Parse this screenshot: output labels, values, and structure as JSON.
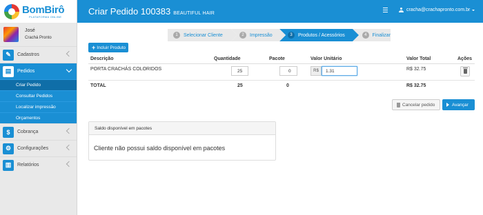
{
  "brand": {
    "name": "BomBirô",
    "subtitle": "PLATAFORMA ONLINE"
  },
  "user": {
    "name": "José",
    "company": "Crachá Pronto"
  },
  "sidebar": {
    "items": [
      {
        "label": "Cadastros",
        "icon": "pencil-icon"
      },
      {
        "label": "Pedidos",
        "icon": "document-icon",
        "active": true
      },
      {
        "label": "Cobrança",
        "icon": "dollar-icon"
      },
      {
        "label": "Configurações",
        "icon": "gears-icon"
      },
      {
        "label": "Relatórios",
        "icon": "bar-chart-icon"
      }
    ],
    "submenu": [
      "Criar Pedido",
      "Consultar Pedidos",
      "Localizar impressão",
      "Orçamentos"
    ]
  },
  "header": {
    "title": "Criar Pedido 100383",
    "subtitle": "BEAUTIFUL HAIR",
    "user_email": "cracha@crachapronto.com.br"
  },
  "wizard": {
    "steps": [
      {
        "num": "1",
        "label": "Selecionar Cliente"
      },
      {
        "num": "2",
        "label": "Impressão"
      },
      {
        "num": "3",
        "label": "Produtos / Acessórios",
        "active": true
      },
      {
        "num": "4",
        "label": "Finalizar"
      }
    ]
  },
  "toolbar": {
    "add_product": "Incluir Produto"
  },
  "table": {
    "headers": {
      "description": "Descrição",
      "quantity": "Quantidade",
      "package": "Pacote",
      "unit_value": "Valor Unitário",
      "total_value": "Valor Total",
      "actions": "Ações"
    },
    "rows": [
      {
        "description": "PORTA CRACHÁS COLORIDOS",
        "quantity": "25",
        "package": "0",
        "currency": "R$",
        "unit_value": "1.31",
        "total_value": "R$ 32.75"
      }
    ],
    "total": {
      "label": "TOTAL",
      "quantity": "25",
      "package": "0",
      "total_value": "R$ 32.75"
    }
  },
  "actions": {
    "cancel": "Cancelar pedido",
    "next": "Avançar"
  },
  "balance_panel": {
    "title": "Saldo disponível em pacotes",
    "message": "Cliente não possui saldo disponível em pacotes"
  },
  "colors": {
    "primary": "#1a8fd4",
    "sidebar_bg": "#e9e9e9"
  }
}
